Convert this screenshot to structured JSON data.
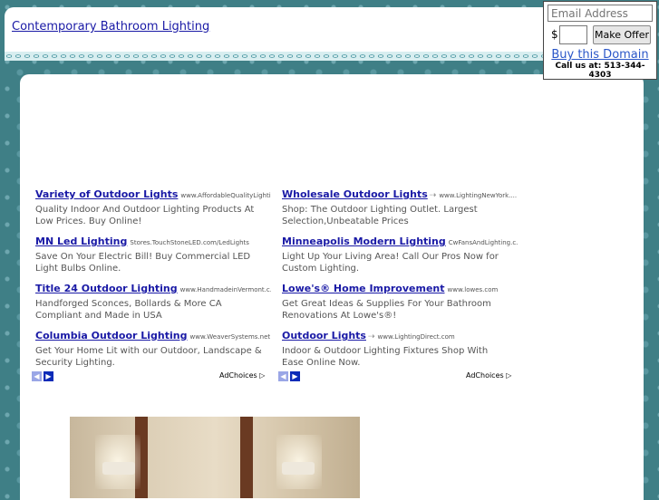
{
  "header": {
    "title": "Contemporary Bathroom Lighting"
  },
  "offer": {
    "email_placeholder": "Email Address",
    "currency": "$",
    "button_label": "Make Offer",
    "buy_link": "Buy this Domain",
    "call_text": "Call us at: 513-344-4303"
  },
  "ads_left": [
    {
      "title": "Variety of Outdoor Lights",
      "url": "www.AffordableQualityLighti...",
      "desc1": "Quality Indoor And Outdoor Lighting Products At",
      "desc2": "Low Prices. Buy Online!"
    },
    {
      "title": "MN Led Lighting",
      "url": "Stores.TouchStoneLED.com/LedLights",
      "desc1": "Save On Your Electric Bill! Buy Commercial LED",
      "desc2": "Light Bulbs Online."
    },
    {
      "title": "Title 24 Outdoor Lighting",
      "url": "www.HandmadeinVermont.c...",
      "desc1": "Handforged Sconces, Bollards & More CA",
      "desc2": "Compliant and Made in USA"
    },
    {
      "title": "Columbia Outdoor Lighting",
      "url": "www.WeaverSystems.net",
      "desc1": "Get Your Home Lit with our Outdoor, Landscape &",
      "desc2": "Security Lighting."
    }
  ],
  "ads_right": [
    {
      "title": "Wholesale Outdoor Lights",
      "url": "www.LightingNewYork....",
      "desc1": "Shop: The Outdoor Lighting Outlet. Largest",
      "desc2": "Selection,Unbeatable Prices"
    },
    {
      "title": "Minneapolis Modern Lighting",
      "url": "CwFansAndLighting.c...",
      "desc1": "Light Up Your Living Area! Call Our Pros Now for",
      "desc2": "Custom Lighting."
    },
    {
      "title": "Lowe's® Home Improvement",
      "url": "www.lowes.com",
      "desc1": "Get Great Ideas & Supplies For Your Bathroom",
      "desc2": "Renovations At Lowe's®!"
    },
    {
      "title": "Outdoor Lights",
      "url": "www.LightingDirect.com",
      "desc1": "Indoor & Outdoor Lighting Fixtures Shop With",
      "desc2": "Ease Online Now."
    }
  ],
  "adchoices": "AdChoices ▷",
  "pager": {
    "prev": "◀",
    "next": "▶"
  }
}
